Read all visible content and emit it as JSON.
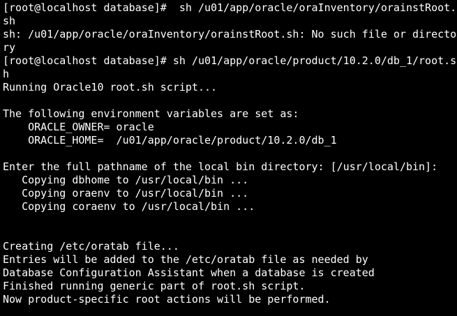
{
  "terminal": {
    "background": "#000000",
    "foreground": "#ffffff",
    "lines": [
      "[root@localhost database]#  sh /u01/app/oracle/oraInventory/orainstRoot.",
      "sh",
      "sh: /u01/app/oracle/oraInventory/orainstRoot.sh: No such file or directo",
      "ry",
      "[root@localhost database]# sh /u01/app/oracle/product/10.2.0/db_1/root.s",
      "h",
      "Running Oracle10 root.sh script...",
      "",
      "The following environment variables are set as:",
      "    ORACLE_OWNER= oracle",
      "    ORACLE_HOME=  /u01/app/oracle/product/10.2.0/db_1",
      "",
      "Enter the full pathname of the local bin directory: [/usr/local/bin]:",
      "   Copying dbhome to /usr/local/bin ...",
      "   Copying oraenv to /usr/local/bin ...",
      "   Copying coraenv to /usr/local/bin ...",
      "",
      "",
      "Creating /etc/oratab file...",
      "Entries will be added to the /etc/oratab file as needed by",
      "Database Configuration Assistant when a database is created",
      "Finished running generic part of root.sh script.",
      "Now product-specific root actions will be performed."
    ]
  }
}
